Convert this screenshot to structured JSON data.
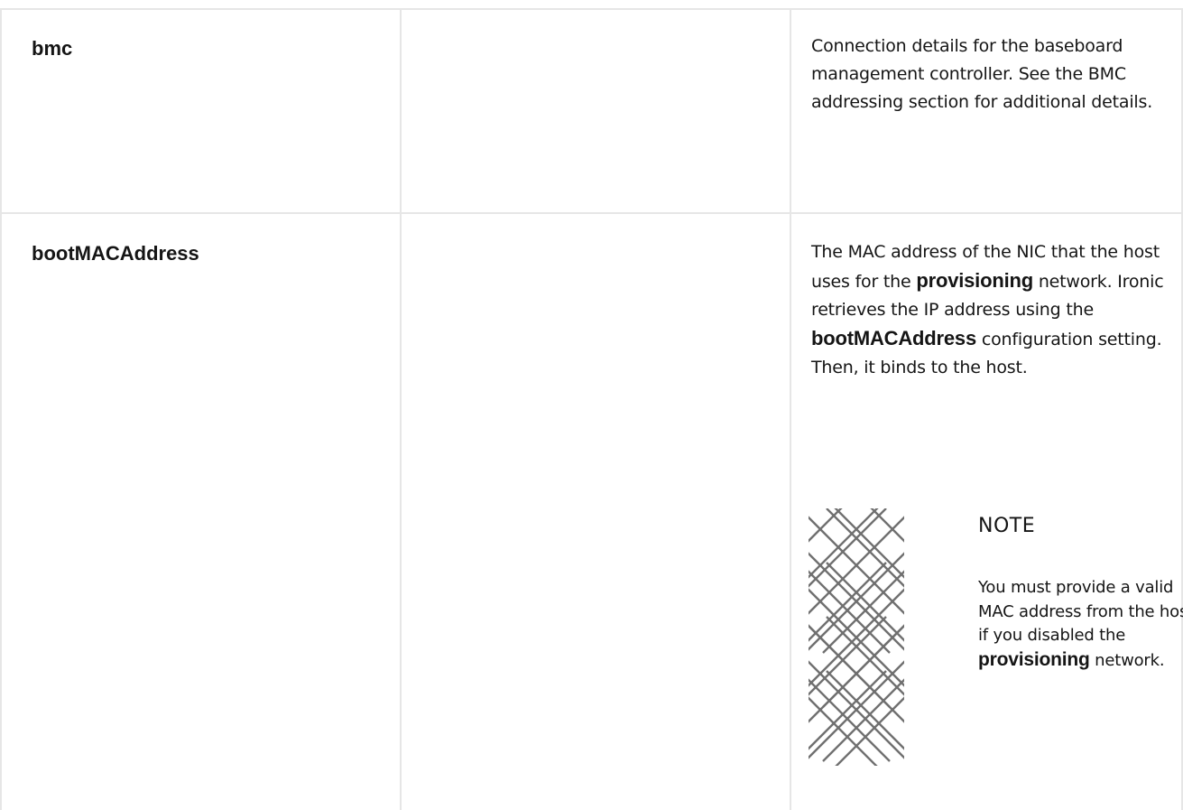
{
  "rows": [
    {
      "parameter": "bmc",
      "description": "Connection details for the baseboard management controller. See the BMC addressing section for additional details."
    },
    {
      "parameter": "bootMACAddress",
      "description_parts": [
        "The MAC address of the NIC that the host uses for the",
        "provisioning",
        "network. Ironic retrieves the IP address using the",
        "bootMACAddress",
        "configuration setting. Then, it binds to the host."
      ],
      "note": {
        "title": "NOTE",
        "body_parts": [
          "You must provide a valid MAC address from the host if you disabled the",
          "provisioning",
          "network."
        ]
      }
    }
  ],
  "colors": {
    "border": "#e6e6e6",
    "text": "#151515",
    "icon": "#707070"
  },
  "icons": {
    "note": "note-pattern-icon"
  }
}
